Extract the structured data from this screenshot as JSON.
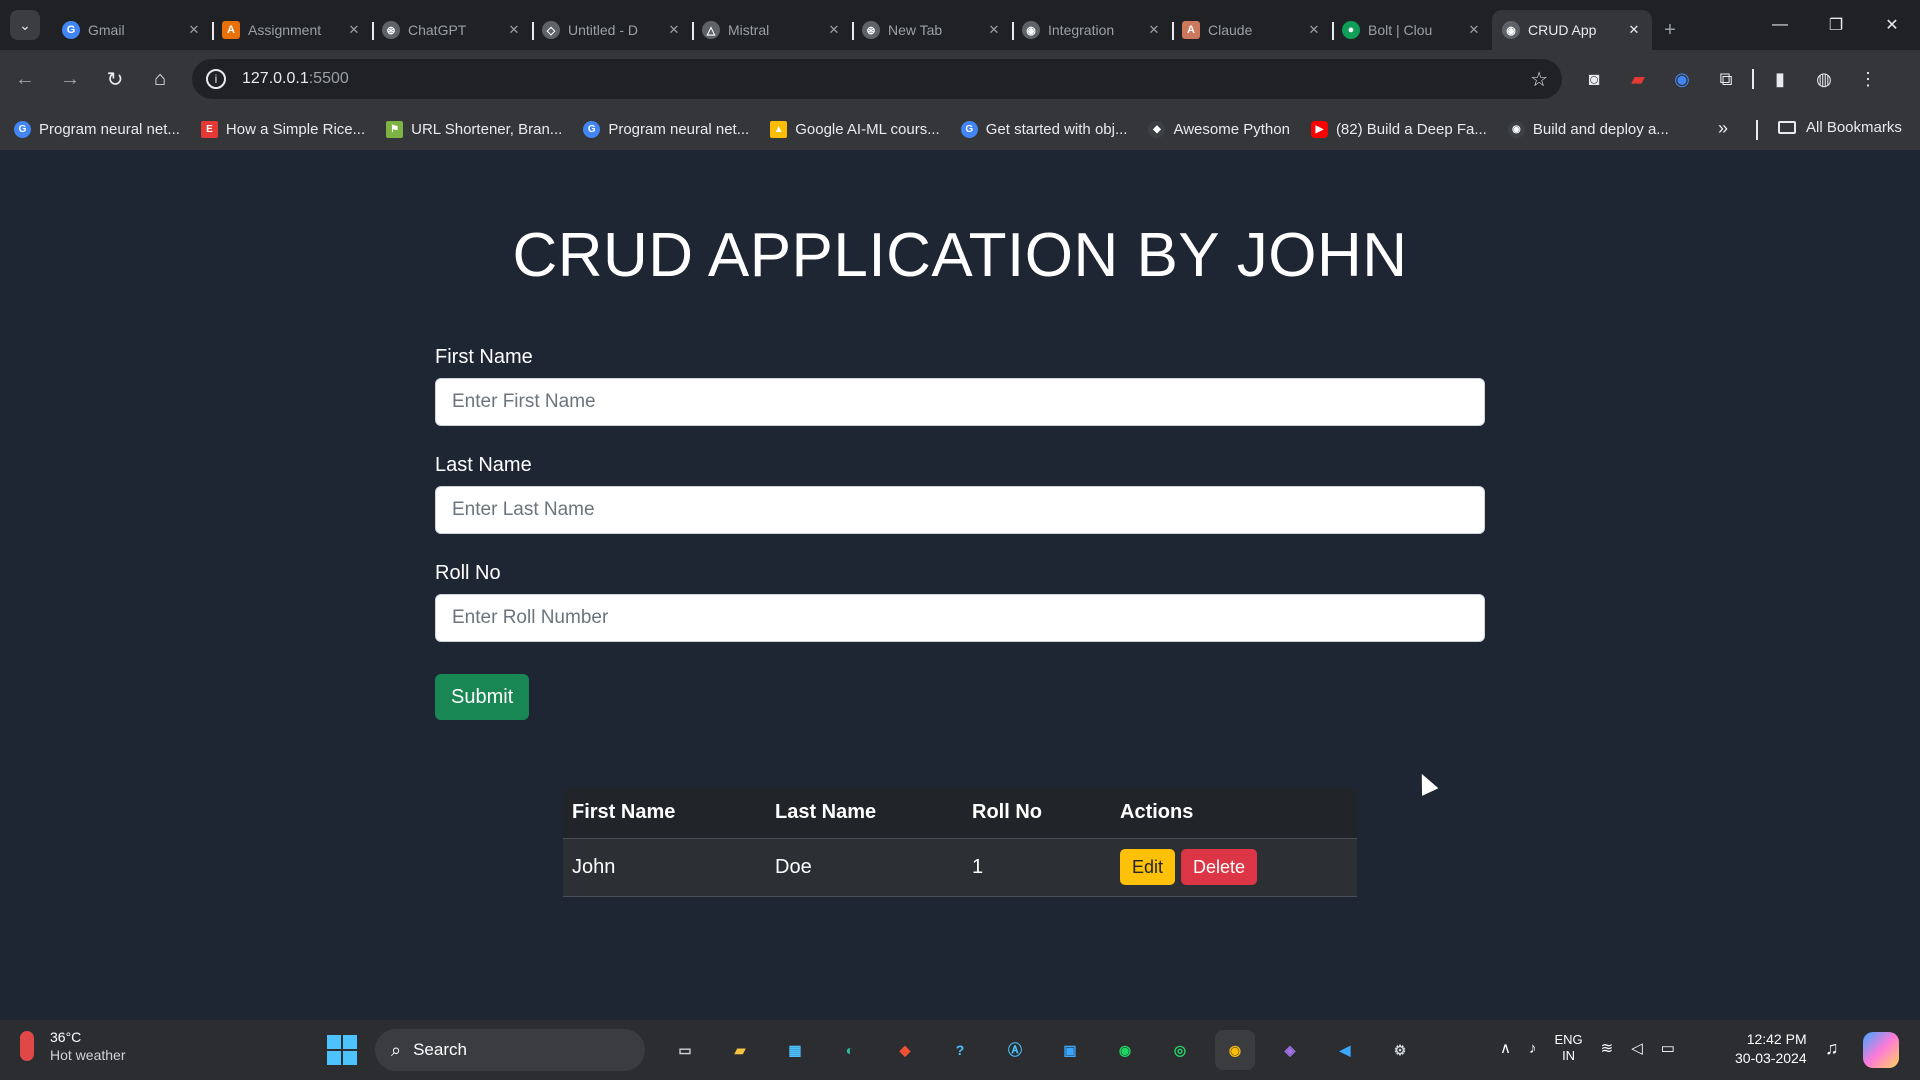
{
  "browser": {
    "tabs": [
      {
        "title": "Gmail",
        "icon": "google-g-icon",
        "color": "#4285f4",
        "glyph": "G"
      },
      {
        "title": "Assignment",
        "icon": "orange-app-icon",
        "color": "#e8710a",
        "glyph": "A"
      },
      {
        "title": "ChatGPT",
        "icon": "openai-icon",
        "color": "#5f6368",
        "glyph": "⊛"
      },
      {
        "title": "Untitled - D",
        "icon": "docs-icon",
        "color": "#5f6368",
        "glyph": "◇"
      },
      {
        "title": "Mistral",
        "icon": "triangle-icon",
        "color": "#5f6368",
        "glyph": "△"
      },
      {
        "title": "New Tab",
        "icon": "openai-icon",
        "color": "#5f6368",
        "glyph": "⊛"
      },
      {
        "title": "Integration",
        "icon": "globe-icon",
        "color": "#5f6368",
        "glyph": "◉"
      },
      {
        "title": "Claude",
        "icon": "claude-icon",
        "color": "#cc785c",
        "glyph": "A"
      },
      {
        "title": "Bolt | Clou",
        "icon": "green-globe-icon",
        "color": "#0f9d58",
        "glyph": "●"
      },
      {
        "title": "CRUD App",
        "icon": "globe-icon",
        "color": "#5f6368",
        "glyph": "◉",
        "active": true
      }
    ],
    "url_main": "127.0.0.1",
    "url_port": ":5500",
    "bookmarks": [
      {
        "label": "Program neural net...",
        "color": "#4285f4",
        "glyph": "G"
      },
      {
        "label": "How a Simple Rice...",
        "color": "#e53935",
        "glyph": "E"
      },
      {
        "label": "URL Shortener, Bran...",
        "color": "#7cb342",
        "glyph": "⚑"
      },
      {
        "label": "Program neural net...",
        "color": "#4285f4",
        "glyph": "G"
      },
      {
        "label": "Google AI-ML cours...",
        "color": "#fbbc04",
        "glyph": "▲"
      },
      {
        "label": "Get started with obj...",
        "color": "#4285f4",
        "glyph": "G"
      },
      {
        "label": "Awesome Python",
        "color": "#3c4043",
        "glyph": "◆"
      },
      {
        "label": "(82) Build a Deep Fa...",
        "color": "#ff0000",
        "glyph": "▶"
      },
      {
        "label": "Build and deploy a...",
        "color": "#3c4043",
        "glyph": "◉"
      }
    ],
    "all_bookmarks": "All Bookmarks"
  },
  "page": {
    "title": "CRUD APPLICATION BY JOHN",
    "form": {
      "first_name_label": "First Name",
      "first_name_placeholder": "Enter First Name",
      "last_name_label": "Last Name",
      "last_name_placeholder": "Enter Last Name",
      "roll_no_label": "Roll No",
      "roll_no_placeholder": "Enter Roll Number",
      "submit_label": "Submit"
    },
    "table": {
      "headers": [
        "First Name",
        "Last Name",
        "Roll No",
        "Actions"
      ],
      "rows": [
        {
          "first_name": "John",
          "last_name": "Doe",
          "roll_no": "1"
        }
      ],
      "edit_label": "Edit",
      "delete_label": "Delete"
    },
    "colors": {
      "background": "#1e2533",
      "submit": "#198754",
      "edit": "#ffc107",
      "delete": "#dc3545"
    }
  },
  "taskbar": {
    "temperature": "36°C",
    "weather": "Hot weather",
    "search_label": "Search",
    "language_line1": "ENG",
    "language_line2": "IN",
    "time": "12:42 PM",
    "date": "30-03-2024"
  }
}
